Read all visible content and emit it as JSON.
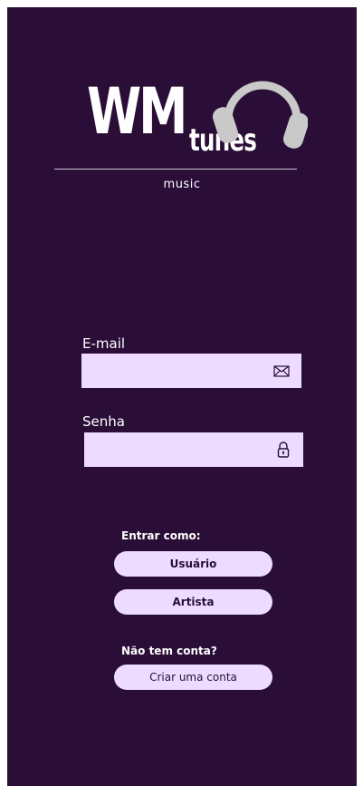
{
  "logo": {
    "wm": "WM",
    "tunes": "tunes",
    "sub": "music"
  },
  "form": {
    "email_label": "E-mail",
    "email_value": "",
    "password_label": "Senha",
    "password_value": ""
  },
  "login_as": {
    "title": "Entrar como:",
    "user_button": "Usuário",
    "artist_button": "Artista"
  },
  "signup": {
    "title": "Não tem conta?",
    "button": "Criar uma conta"
  },
  "icons": {
    "email": "envelope-icon",
    "password": "lock-icon",
    "logo": "headphones-icon"
  },
  "colors": {
    "background": "#2a0e37",
    "field": "#eddcff",
    "text": "#ffffff"
  }
}
